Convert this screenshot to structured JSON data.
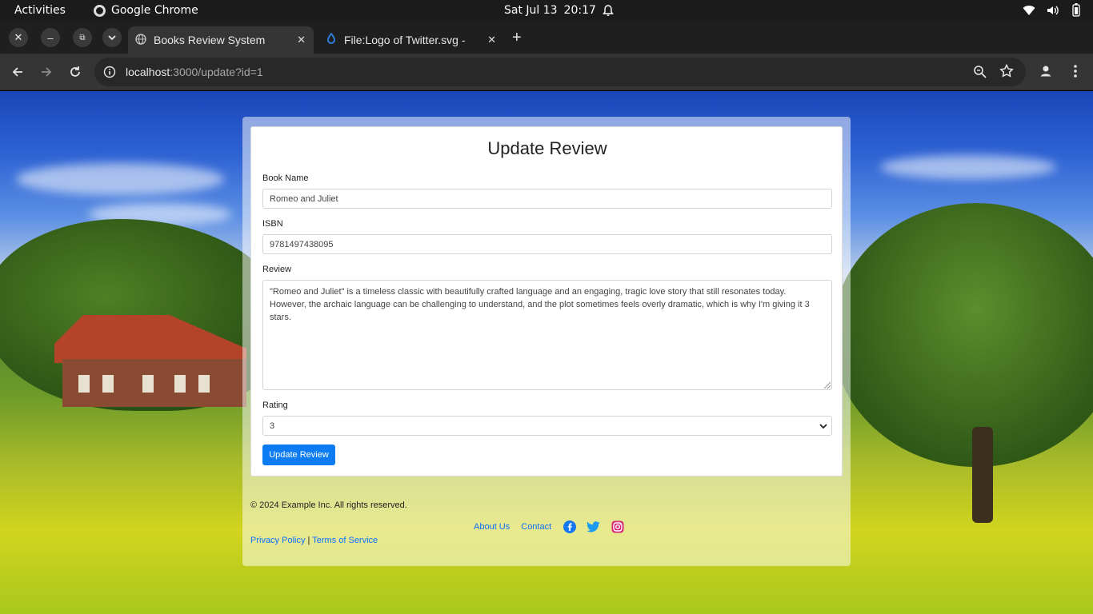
{
  "system": {
    "activities": "Activities",
    "app_name": "Google Chrome",
    "date": "Sat Jul 13",
    "time": "20:17"
  },
  "browser": {
    "tabs": [
      {
        "title": "Books Review System",
        "active": true
      },
      {
        "title": "File:Logo of Twitter.svg -",
        "active": false
      }
    ],
    "url_host": "localhost",
    "url_rest": ":3000/update?id=1"
  },
  "form": {
    "heading": "Update Review",
    "book_label": "Book Name",
    "book_value": "Romeo and Juliet",
    "isbn_label": "ISBN",
    "isbn_value": "9781497438095",
    "review_label": "Review",
    "review_value": "\"Romeo and Juliet\" is a timeless classic with beautifully crafted language and an engaging, tragic love story that still resonates today. However, the archaic language can be challenging to understand, and the plot sometimes feels overly dramatic, which is why I'm giving it 3 stars.",
    "rating_label": "Rating",
    "rating_value": "3",
    "submit_label": "Update Review"
  },
  "footer": {
    "copyright": "© 2024 Example Inc. All rights reserved.",
    "about": "About Us",
    "contact": "Contact",
    "privacy": "Privacy Policy",
    "separator": "|",
    "terms": "Terms of Service"
  },
  "icons": {
    "facebook": "facebook-icon",
    "twitter": "twitter-icon",
    "instagram": "instagram-icon"
  },
  "colors": {
    "primary": "#0d7cf2",
    "link": "#0d6efd",
    "facebook": "#1877f2",
    "twitter": "#1d9bf0",
    "instagram": "#d62976"
  }
}
